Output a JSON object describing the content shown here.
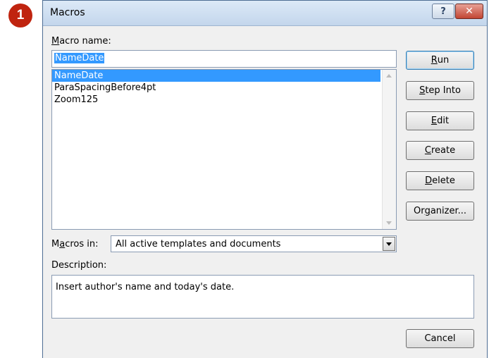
{
  "badge": "1",
  "window": {
    "title": "Macros",
    "help_label": "?",
    "close_label": "✕"
  },
  "macro_name": {
    "label_accel": "M",
    "label_rest": "acro name:",
    "value": "NameDate"
  },
  "macros": [
    "NameDate",
    "ParaSpacingBefore4pt",
    "Zoom125"
  ],
  "selected_index": 0,
  "buttons": {
    "run": {
      "accel": "R",
      "rest": "un"
    },
    "step_into": {
      "accel": "S",
      "rest": "tep Into"
    },
    "edit": {
      "accel": "E",
      "rest": "dit"
    },
    "create": {
      "accel": "C",
      "rest": "reate"
    },
    "delete": {
      "accel": "D",
      "rest": "elete"
    },
    "organizer": {
      "pre": "Or",
      "accel": "g",
      "rest": "anizer..."
    },
    "cancel": "Cancel"
  },
  "macros_in": {
    "label_pre": "M",
    "label_accel": "a",
    "label_rest": "cros in:",
    "value": "All active templates and documents"
  },
  "description": {
    "label": "Description:",
    "text": "Insert author's name and today's date."
  },
  "colors": {
    "selection": "#3399ff",
    "badge": "#c0240f",
    "titlebar": "#c3d6ec"
  }
}
